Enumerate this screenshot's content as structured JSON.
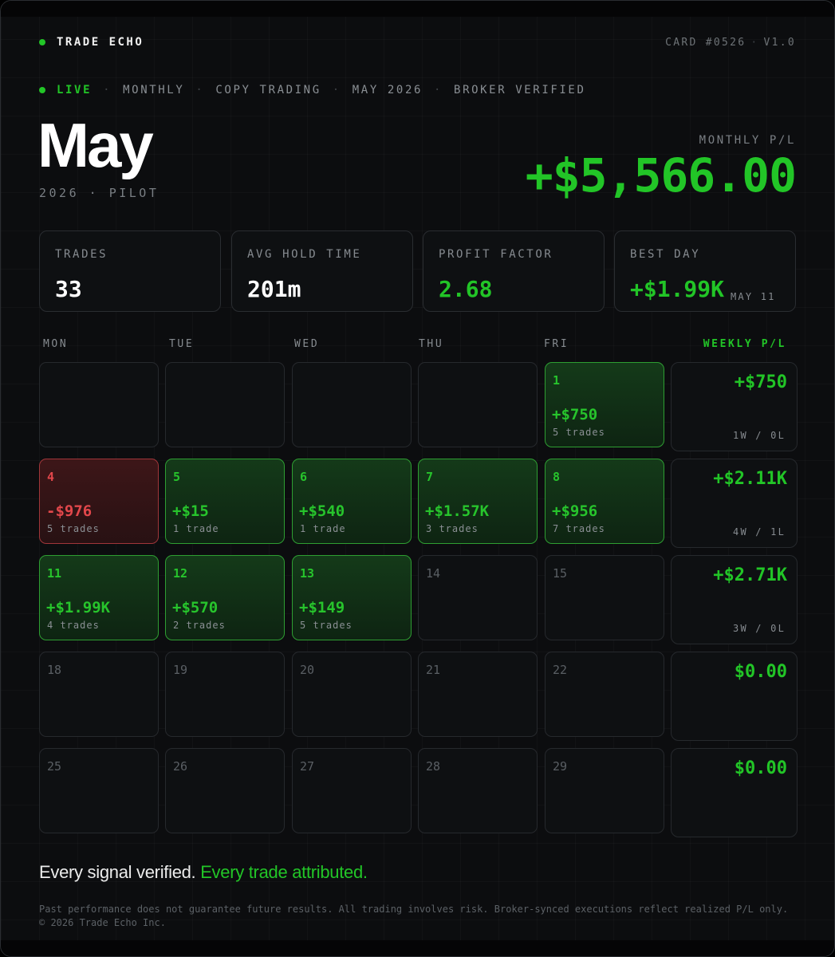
{
  "header": {
    "brand": "TRADE ECHO",
    "card_id": "CARD #0526",
    "version": "V1.0"
  },
  "tags": [
    "LIVE",
    "MONTHLY",
    "COPY TRADING",
    "MAY 2026",
    "BROKER VERIFIED"
  ],
  "title": {
    "month": "May",
    "subtitle": "2026 · PILOT"
  },
  "monthly_pl": {
    "label": "MONTHLY P/L",
    "value": "+$5,566.00"
  },
  "stats": [
    {
      "label": "TRADES",
      "value": "33",
      "note": ""
    },
    {
      "label": "AVG HOLD TIME",
      "value": "201m",
      "note": ""
    },
    {
      "label": "PROFIT FACTOR",
      "value": "2.68",
      "note": ""
    },
    {
      "label": "BEST DAY",
      "value": "+$1.99K",
      "note": "MAY 11"
    }
  ],
  "calendar": {
    "headers": [
      "MON",
      "TUE",
      "WED",
      "THU",
      "FRI"
    ],
    "weekly_header": "WEEKLY P/L",
    "days": [
      {
        "day": "1",
        "pl": "+$750",
        "trades": "5 trades",
        "status": "positive"
      },
      {
        "day": "4",
        "pl": "-$976",
        "trades": "5 trades",
        "status": "negative"
      },
      {
        "day": "5",
        "pl": "+$15",
        "trades": "1 trade",
        "status": "positive"
      },
      {
        "day": "6",
        "pl": "+$540",
        "trades": "1 trade",
        "status": "positive"
      },
      {
        "day": "7",
        "pl": "+$1.57K",
        "trades": "3 trades",
        "status": "positive"
      },
      {
        "day": "8",
        "pl": "+$956",
        "trades": "7 trades",
        "status": "positive"
      },
      {
        "day": "11",
        "pl": "+$1.99K",
        "trades": "4 trades",
        "status": "positive"
      },
      {
        "day": "12",
        "pl": "+$570",
        "trades": "2 trades",
        "status": "positive"
      },
      {
        "day": "13",
        "pl": "+$149",
        "trades": "5 trades",
        "status": "positive"
      },
      {
        "day": "14",
        "pl": "",
        "trades": "",
        "status": "empty"
      },
      {
        "day": "15",
        "pl": "",
        "trades": "",
        "status": "empty"
      },
      {
        "day": "18",
        "pl": "",
        "trades": "",
        "status": "empty"
      },
      {
        "day": "19",
        "pl": "",
        "trades": "",
        "status": "empty"
      },
      {
        "day": "20",
        "pl": "",
        "trades": "",
        "status": "empty"
      },
      {
        "day": "21",
        "pl": "",
        "trades": "",
        "status": "empty"
      },
      {
        "day": "22",
        "pl": "",
        "trades": "",
        "status": "empty"
      },
      {
        "day": "25",
        "pl": "",
        "trades": "",
        "status": "empty"
      },
      {
        "day": "26",
        "pl": "",
        "trades": "",
        "status": "empty"
      },
      {
        "day": "27",
        "pl": "",
        "trades": "",
        "status": "empty"
      },
      {
        "day": "28",
        "pl": "",
        "trades": "",
        "status": "empty"
      },
      {
        "day": "29",
        "pl": "",
        "trades": "",
        "status": "empty"
      }
    ],
    "weeks": [
      {
        "pl": "+$750",
        "record": "1W / 0L"
      },
      {
        "pl": "+$2.11K",
        "record": "4W / 1L"
      },
      {
        "pl": "+$2.71K",
        "record": "3W / 0L"
      },
      {
        "pl": "$0.00",
        "record": ""
      },
      {
        "pl": "$0.00",
        "record": ""
      }
    ]
  },
  "footer": {
    "tagline_1": "Every signal verified.",
    "tagline_2": "Every trade attributed.",
    "disclaimer": "Past performance does not guarantee future results. All trading involves risk. Broker-synced executions reflect realized P/L only. © 2026 Trade Echo Inc."
  },
  "colors": {
    "accent": "#22c527",
    "negative": "#e2474b",
    "background": "#0c0d0f"
  }
}
